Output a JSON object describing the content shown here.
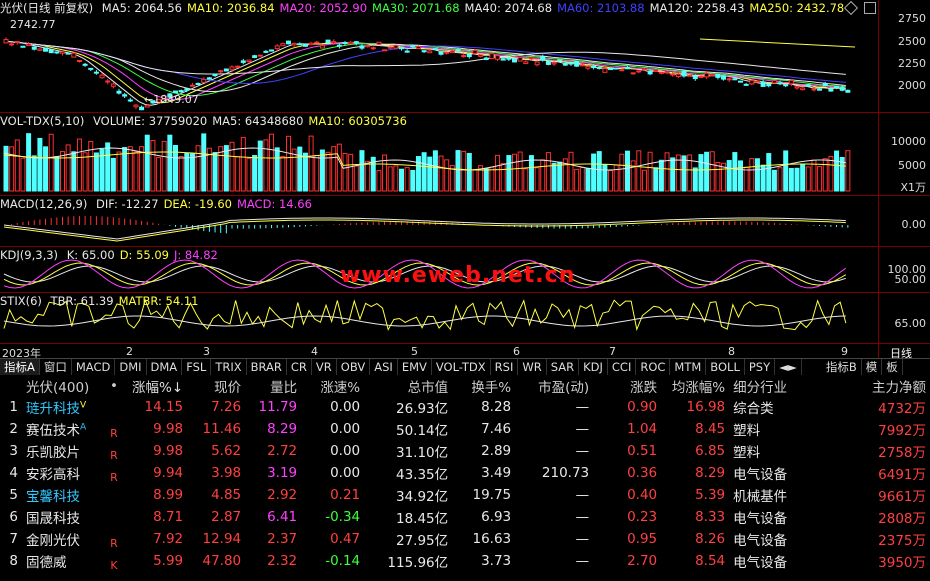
{
  "main": {
    "title": "光伏(日线 前复权)",
    "ma": [
      {
        "label": "MA5: 2064.56",
        "color": "#e8e8e8"
      },
      {
        "label": "MA10: 2036.84",
        "color": "#ffff40"
      },
      {
        "label": "MA20: 2052.90",
        "color": "#ff40ff"
      },
      {
        "label": "MA30: 2071.68",
        "color": "#40ff40"
      },
      {
        "label": "MA40: 2074.68",
        "color": "#e8e8e8"
      },
      {
        "label": "MA60: 2103.88",
        "color": "#4040ff"
      },
      {
        "label": "MA120: 2258.43",
        "color": "#e8e8e8"
      },
      {
        "label": "MA250: 2432.78",
        "color": "#ffff40"
      }
    ],
    "high_label": "2742.77",
    "low_label": "1849.07",
    "axis": [
      "2750",
      "2500",
      "2250",
      "2000"
    ]
  },
  "vol": {
    "title": "VOL-TDX(5,10)",
    "items": [
      {
        "label": "VOLUME: 37759020",
        "color": "#e8e8e8"
      },
      {
        "label": "MA5: 64348680",
        "color": "#e8e8e8"
      },
      {
        "label": "MA10: 60305736",
        "color": "#ffff40"
      }
    ],
    "axis": [
      "10000",
      "5000"
    ],
    "unit": "X1万"
  },
  "macd": {
    "title": "MACD(12,26,9)",
    "items": [
      {
        "label": "DIF: -12.27",
        "color": "#e8e8e8"
      },
      {
        "label": "DEA: -19.60",
        "color": "#ffff40"
      },
      {
        "label": "MACD: 14.66",
        "color": "#ff40ff"
      }
    ],
    "axis": [
      "0.00"
    ]
  },
  "kdj": {
    "title": "KDJ(9,3,3)",
    "items": [
      {
        "label": "K: 65.00",
        "color": "#e8e8e8"
      },
      {
        "label": "D: 55.09",
        "color": "#ffff40"
      },
      {
        "label": "J: 84.82",
        "color": "#ff40ff"
      }
    ],
    "axis": [
      "100.00",
      "50.00"
    ],
    "watermark": "www.eweb.net.cn"
  },
  "stix": {
    "title": "STIX(6)",
    "items": [
      {
        "label": "TBR: 61.39",
        "color": "#e8e8e8"
      },
      {
        "label": "MATBR: 54.11",
        "color": "#ffff40"
      }
    ],
    "axis": [
      "65.00"
    ]
  },
  "timeline": {
    "year": "2023年",
    "months": [
      "2",
      "3",
      "4",
      "5",
      "6",
      "7",
      "8",
      "9"
    ],
    "period": "日线"
  },
  "tabs": [
    "指标A",
    "窗口",
    "MACD",
    "DMI",
    "DMA",
    "FSL",
    "TRIX",
    "BRAR",
    "CR",
    "VR",
    "OBV",
    "ASI",
    "EMV",
    "VOL-TDX",
    "RSI",
    "WR",
    "SAR",
    "KDJ",
    "CCI",
    "ROC",
    "MTM",
    "BOLL",
    "PSY",
    "◄►",
    "指标B",
    "模",
    "板"
  ],
  "table": {
    "headers": [
      "",
      "光伏(400)",
      "•",
      "涨幅%↓",
      "现价",
      "量比",
      "涨速%",
      "总市值",
      "换手%",
      "市盈(动)",
      "涨跌",
      "均涨幅%",
      "细分行业",
      "主力净额"
    ],
    "rows": [
      {
        "no": "1",
        "name": "琏升科技",
        "name_color": "#30c8ff",
        "sup": "V",
        "flag": "",
        "chg": "14.15",
        "price": "7.26",
        "vr": "11.79",
        "vr_color": "#ff40ff",
        "spd": "0.00",
        "spd_color": "#e8e8e8",
        "mcap": "26.93亿",
        "turn": "8.28",
        "pe": "—",
        "diff": "0.90",
        "avg": "16.98",
        "ind": "综合类",
        "net": "4732万"
      },
      {
        "no": "2",
        "name": "赛伍技术",
        "name_color": "#e8e8e8",
        "sup": "A",
        "flag": "R",
        "chg": "9.98",
        "price": "11.46",
        "vr": "8.29",
        "vr_color": "#ff40ff",
        "spd": "0.00",
        "spd_color": "#e8e8e8",
        "mcap": "50.14亿",
        "turn": "7.46",
        "pe": "—",
        "diff": "1.04",
        "avg": "8.45",
        "ind": "塑料",
        "net": "7992万"
      },
      {
        "no": "3",
        "name": "乐凯胶片",
        "name_color": "#e8e8e8",
        "sup": "",
        "flag": "R",
        "chg": "9.98",
        "price": "5.62",
        "vr": "2.72",
        "vr_color": "#ff4040",
        "spd": "0.00",
        "spd_color": "#e8e8e8",
        "mcap": "31.10亿",
        "turn": "2.89",
        "pe": "—",
        "diff": "0.51",
        "avg": "6.85",
        "ind": "塑料",
        "net": "2758万"
      },
      {
        "no": "4",
        "name": "安彩高科",
        "name_color": "#e8e8e8",
        "sup": "",
        "flag": "R",
        "chg": "9.94",
        "price": "3.98",
        "vr": "3.19",
        "vr_color": "#ff40ff",
        "spd": "0.00",
        "spd_color": "#e8e8e8",
        "mcap": "43.35亿",
        "turn": "3.49",
        "pe": "210.73",
        "diff": "0.36",
        "avg": "8.29",
        "ind": "电气设备",
        "net": "6491万"
      },
      {
        "no": "5",
        "name": "宝馨科技",
        "name_color": "#30c8ff",
        "sup": "",
        "flag": "",
        "chg": "8.99",
        "price": "4.85",
        "vr": "2.92",
        "vr_color": "#ff4040",
        "spd": "0.21",
        "spd_color": "#ff4040",
        "mcap": "34.92亿",
        "turn": "19.75",
        "pe": "—",
        "diff": "0.40",
        "avg": "5.39",
        "ind": "机械基件",
        "net": "9661万"
      },
      {
        "no": "6",
        "name": "国晟科技",
        "name_color": "#e8e8e8",
        "sup": "",
        "flag": "",
        "chg": "8.71",
        "price": "2.87",
        "vr": "6.41",
        "vr_color": "#ff40ff",
        "spd": "-0.34",
        "spd_color": "#3cff3c",
        "mcap": "18.45亿",
        "turn": "6.93",
        "pe": "—",
        "diff": "0.23",
        "avg": "8.33",
        "ind": "电气设备",
        "net": "2808万"
      },
      {
        "no": "7",
        "name": "金刚光伏",
        "name_color": "#e8e8e8",
        "sup": "",
        "flag": "R",
        "chg": "7.92",
        "price": "12.94",
        "vr": "2.37",
        "vr_color": "#ff4040",
        "spd": "0.47",
        "spd_color": "#ff4040",
        "mcap": "27.95亿",
        "turn": "16.63",
        "pe": "—",
        "diff": "0.95",
        "avg": "8.26",
        "ind": "电气设备",
        "net": "2375万"
      },
      {
        "no": "8",
        "name": "固德威",
        "name_color": "#e8e8e8",
        "sup": "",
        "flag": "K",
        "chg": "5.99",
        "price": "47.80",
        "vr": "2.32",
        "vr_color": "#ff4040",
        "spd": "-0.14",
        "spd_color": "#3cff3c",
        "mcap": "115.96亿",
        "turn": "3.73",
        "pe": "—",
        "diff": "2.70",
        "avg": "8.54",
        "ind": "电气设备",
        "net": "3950万"
      }
    ]
  }
}
